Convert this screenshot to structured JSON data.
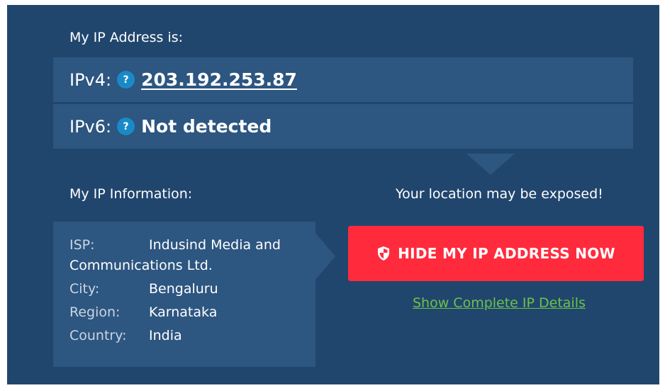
{
  "ip_section": {
    "heading": "My IP Address is:",
    "ipv4": {
      "label": "IPv4:",
      "help": "?",
      "value": "203.192.253.87"
    },
    "ipv6": {
      "label": "IPv6:",
      "help": "?",
      "value": "Not detected"
    }
  },
  "info_section": {
    "heading": "My IP Information:",
    "isp": {
      "key": "ISP:",
      "value_line1": "Indusind Media and",
      "value_line2": "Communications Ltd."
    },
    "city": {
      "key": "City:",
      "value": "Bengaluru"
    },
    "region": {
      "key": "Region:",
      "value": "Karnataka"
    },
    "country": {
      "key": "Country:",
      "value": "India"
    }
  },
  "cta": {
    "warning": "Your location may be exposed!",
    "button_label": "HIDE MY IP ADDRESS NOW",
    "details_link": "Show Complete IP Details"
  },
  "colors": {
    "panel_bg": "#21466e",
    "row_bg": "#2d5680",
    "button_red": "#ff2b3d",
    "link_green": "#6cc24a",
    "help_blue": "#1a8ac7"
  },
  "icons": {
    "help": "question-mark-icon",
    "shield": "shield-icon"
  }
}
